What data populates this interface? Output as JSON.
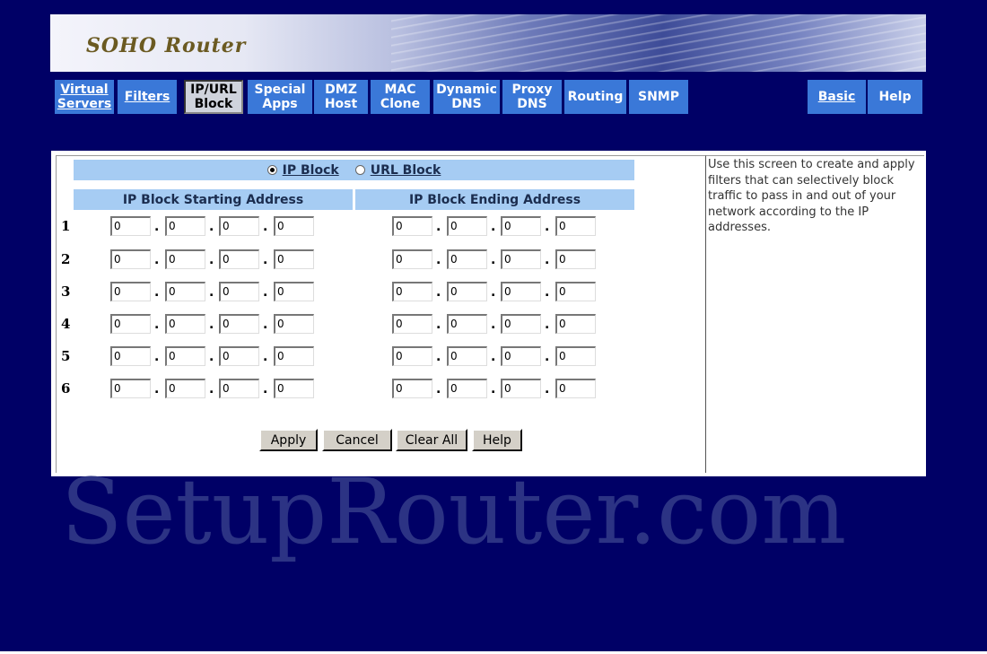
{
  "banner": {
    "logo": "SOHO Router"
  },
  "nav": [
    {
      "label": "Virtual\nServers",
      "underline": true
    },
    {
      "label": "Filters",
      "underline": true
    },
    {
      "label": "IP/URL\nBlock",
      "active": true
    },
    {
      "label": "Special\nApps"
    },
    {
      "label": "DMZ\nHost"
    },
    {
      "label": "MAC\nClone"
    },
    {
      "label": "Dynamic\nDNS"
    },
    {
      "label": "Proxy\nDNS"
    },
    {
      "label": "Routing"
    },
    {
      "label": "SNMP"
    },
    {
      "label": "Basic",
      "underline": true
    },
    {
      "label": "Help"
    }
  ],
  "mode": {
    "ip_block_label": "IP Block",
    "url_block_label": "URL Block",
    "selected": "IP Block"
  },
  "headers": {
    "start": "IP Block Starting Address",
    "end": "IP Block Ending Address"
  },
  "rows": [
    {
      "num": "1",
      "start": [
        "0",
        "0",
        "0",
        "0"
      ],
      "end": [
        "0",
        "0",
        "0",
        "0"
      ]
    },
    {
      "num": "2",
      "start": [
        "0",
        "0",
        "0",
        "0"
      ],
      "end": [
        "0",
        "0",
        "0",
        "0"
      ]
    },
    {
      "num": "3",
      "start": [
        "0",
        "0",
        "0",
        "0"
      ],
      "end": [
        "0",
        "0",
        "0",
        "0"
      ]
    },
    {
      "num": "4",
      "start": [
        "0",
        "0",
        "0",
        "0"
      ],
      "end": [
        "0",
        "0",
        "0",
        "0"
      ]
    },
    {
      "num": "5",
      "start": [
        "0",
        "0",
        "0",
        "0"
      ],
      "end": [
        "0",
        "0",
        "0",
        "0"
      ]
    },
    {
      "num": "6",
      "start": [
        "0",
        "0",
        "0",
        "0"
      ],
      "end": [
        "0",
        "0",
        "0",
        "0"
      ]
    }
  ],
  "buttons": {
    "apply": "Apply",
    "cancel": "Cancel",
    "clear_all": "Clear All",
    "help": "Help"
  },
  "help_text": "Use this screen to create and apply filters that can selectively block traffic to pass in and out of your network according to the IP addresses.",
  "watermark": "SetupRouter.com",
  "colors": {
    "page_bg": "#000066",
    "nav_button": "#3a78d8",
    "header_bar": "#a6ccf3"
  }
}
